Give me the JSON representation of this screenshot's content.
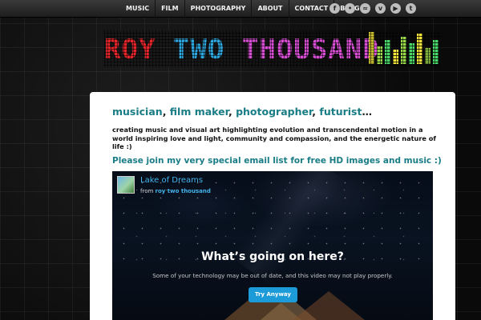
{
  "nav": {
    "items": [
      {
        "label": "MUSIC"
      },
      {
        "label": "FILM"
      },
      {
        "label": "PHOTOGRAPHY"
      },
      {
        "label": "ABOUT"
      },
      {
        "label": "CONTACT"
      },
      {
        "label": "BLOG"
      }
    ]
  },
  "social": {
    "icons": [
      {
        "name": "facebook-icon",
        "glyph": "f"
      },
      {
        "name": "flickr-icon",
        "glyph": "•"
      },
      {
        "name": "soundcloud-icon",
        "glyph": "≈"
      },
      {
        "name": "vimeo-icon",
        "glyph": "v"
      },
      {
        "name": "youtube-icon",
        "glyph": "▶"
      },
      {
        "name": "twitter-icon",
        "glyph": "t"
      }
    ]
  },
  "logo": {
    "word1": "ROY",
    "word2": "TWO",
    "word3": "THOUSAND",
    "colors": {
      "word1": "#e8262a",
      "word2": "#2ea8e0",
      "word3": "#d84fd6",
      "accent": "#f2e43a"
    }
  },
  "content": {
    "roles": [
      "musician",
      "film maker",
      "photographer",
      "futurist"
    ],
    "separator": ",",
    "ellipsis": "…",
    "intro": "creating music and visual art highlighting evolution and transcendental motion in a world inspiring love and light, community and compassion, and the energetic nature of life :)",
    "email_cta": "Please join my very special email list for free HD images and music :)"
  },
  "video": {
    "title": "Lake of Dreams",
    "from_prefix": "from",
    "author": "roy two thousand",
    "heading": "What’s going on here?",
    "message": "Some of your technology may be out of date, and this video may not play properly.",
    "button": "Try Anyway"
  },
  "colors": {
    "accent": "#1a7d86",
    "link_blue": "#44b4ec",
    "button_blue": "#1d9ad8"
  }
}
